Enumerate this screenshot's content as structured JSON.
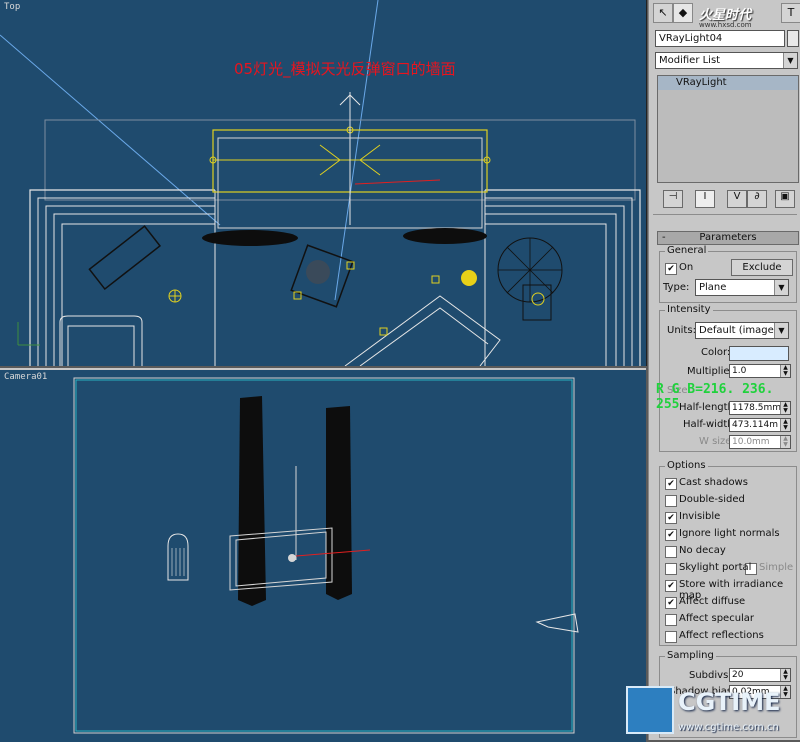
{
  "viewports": {
    "top": {
      "label": "Top",
      "annotation": "05灯光_模拟天光反弹窗口的墙面"
    },
    "camera": {
      "label": "Camera01"
    }
  },
  "watermark_top": {
    "brand": "火星时代",
    "url": "www.hxsd.com"
  },
  "watermark_bottom": {
    "brand": "CGTIME",
    "url": "www.cgtime.com.cn"
  },
  "overlay_rgb": "R G B=216. 236. 255",
  "panel": {
    "object_name": "VRayLight04",
    "modifier_list": "Modifier List",
    "stack_item": "VRayLight",
    "rollout_title": "Parameters",
    "rollout_toggle": "-",
    "general": {
      "title": "General",
      "on_label": "On",
      "exclude_button": "Exclude",
      "type_label": "Type:",
      "type_value": "Plane"
    },
    "intensity": {
      "title": "Intensity",
      "units_label": "Units:",
      "units_value": "Default (image)",
      "color_label": "Color:",
      "color_hex": "#d8ecff",
      "multiplier_label": "Multiplier:",
      "multiplier_value": "1.0",
      "size_label": "Size",
      "half_length_label": "Half-length:",
      "half_length_value": "1178.5mm",
      "half_width_label": "Half-width:",
      "half_width_value": "473.114m",
      "w_size_label": "W size",
      "w_size_value": "10.0mm"
    },
    "options": {
      "title": "Options",
      "items": [
        {
          "label": "Cast shadows",
          "checked": true
        },
        {
          "label": "Double-sided",
          "checked": false
        },
        {
          "label": "Invisible",
          "checked": true
        },
        {
          "label": "Ignore light normals",
          "checked": true
        },
        {
          "label": "No decay",
          "checked": false
        },
        {
          "label": "Skylight portal",
          "checked": false
        },
        {
          "label": "Store with irradiance map",
          "checked": true
        },
        {
          "label": "Affect diffuse",
          "checked": true
        },
        {
          "label": "Affect specular",
          "checked": false
        },
        {
          "label": "Affect reflections",
          "checked": false
        }
      ],
      "simple_label": "Simple"
    },
    "sampling": {
      "title": "Sampling",
      "subdivs_label": "Subdivs:",
      "subdivs_value": "20",
      "shadow_bias_label": "Shadow bias:",
      "shadow_bias_value": "0.02mm"
    }
  },
  "colors": {
    "viewport_bg": "#1f4b6e",
    "annotation_red": "#e8141e",
    "overlay_green": "#1fd23c",
    "wire_yellow": "#e0d020"
  }
}
